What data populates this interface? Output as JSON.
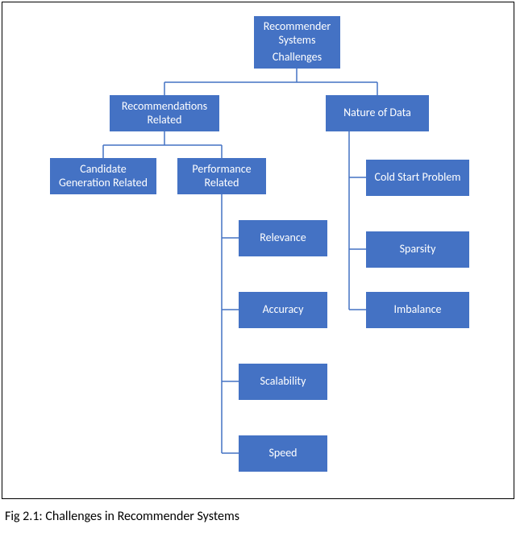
{
  "caption": "Fig 2.1: Challenges in Recommender Systems",
  "nodes": {
    "root_l1": "Recommender",
    "root_l2": "Systems",
    "root_l3": "Challenges",
    "rec_related_l1": "Recommendations",
    "rec_related_l2": "Related",
    "nature_data": "Nature of Data",
    "cand_gen_l1": "Candidate",
    "cand_gen_l2": "Generation Related",
    "perf_related_l1": "Performance",
    "perf_related_l2": "Related",
    "relevance": "Relevance",
    "accuracy": "Accuracy",
    "scalability": "Scalability",
    "speed": "Speed",
    "cold_start": "Cold Start Problem",
    "sparsity": "Sparsity",
    "imbalance": "Imbalance"
  }
}
